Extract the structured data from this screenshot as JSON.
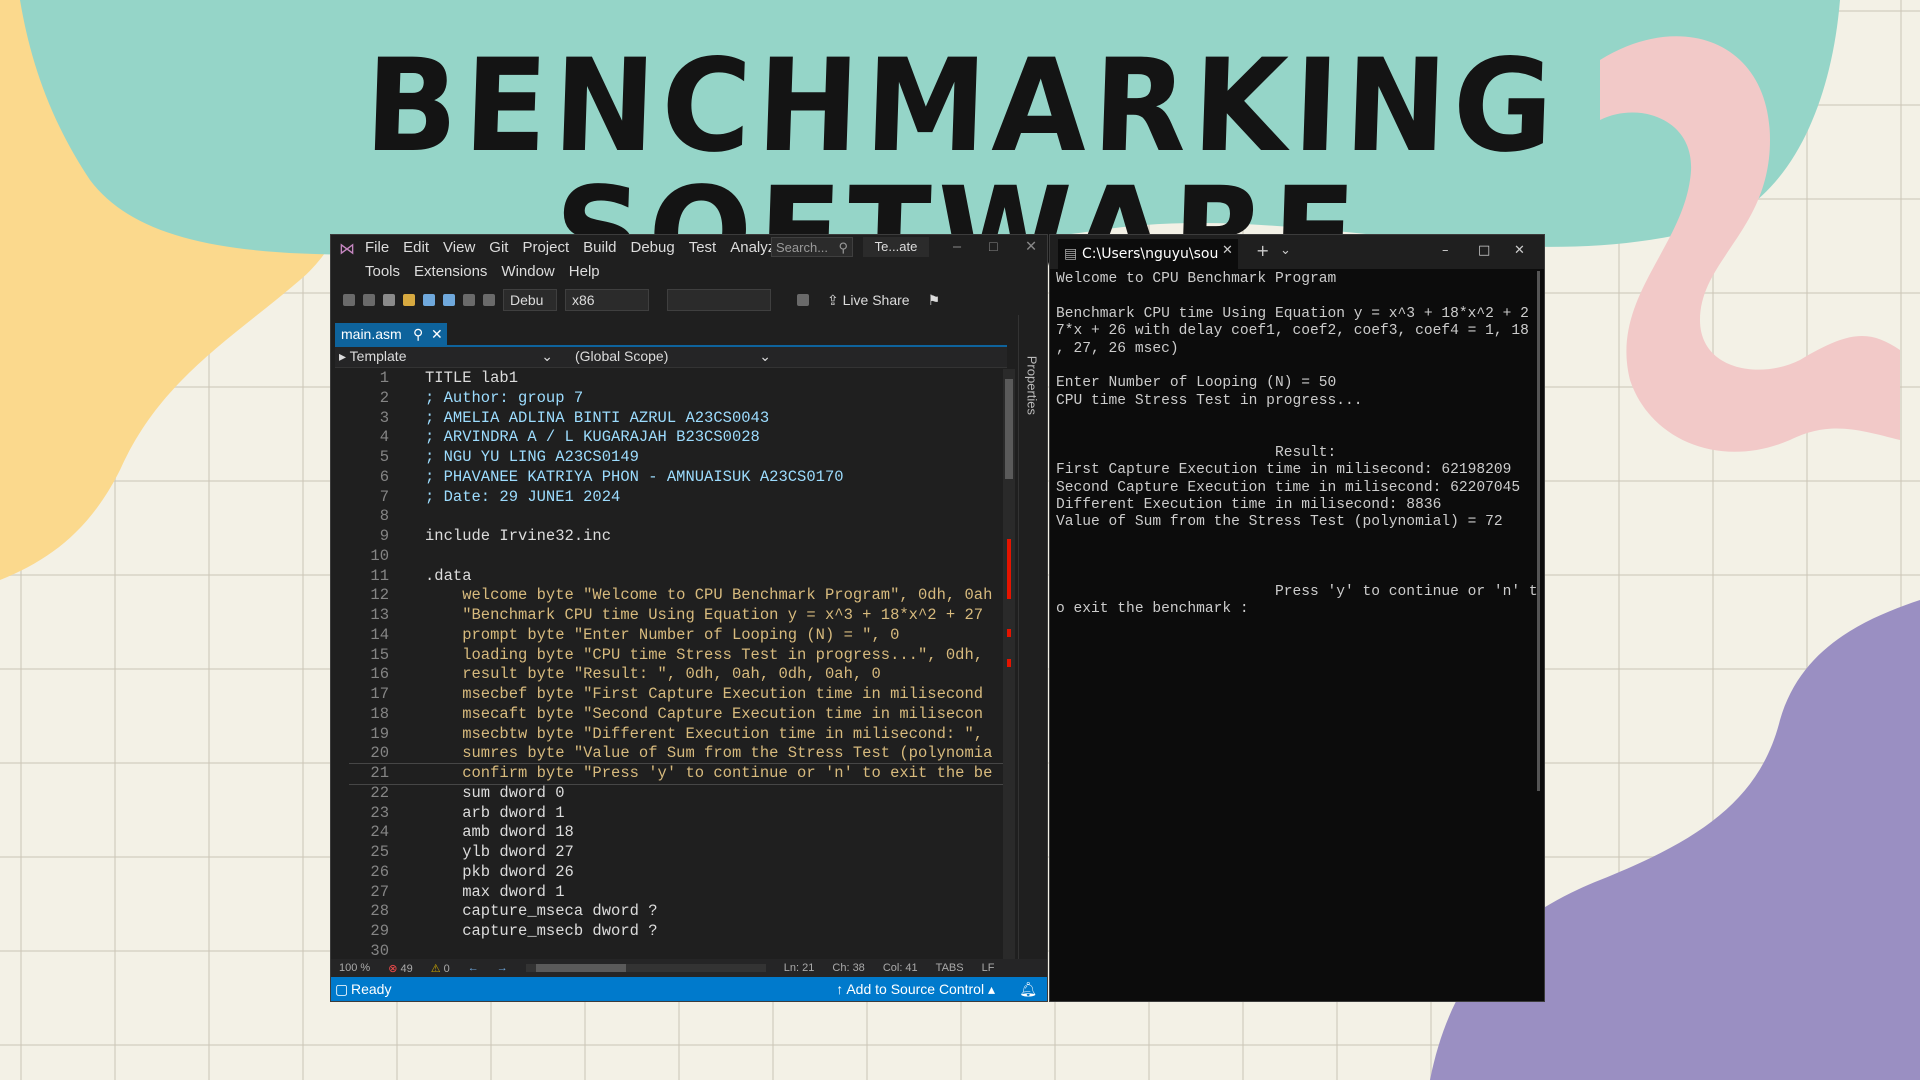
{
  "slide": {
    "title": "BENCHMARKING SOFTWARE",
    "colors": {
      "teal": "#95d5c8",
      "yellow": "#fbd98d",
      "pink": "#f2c9c8",
      "purple": "#9a8fc2",
      "background": "#f3f1e6"
    }
  },
  "vs": {
    "menu_row1": [
      "File",
      "Edit",
      "View",
      "Git",
      "Project",
      "Build",
      "Debug",
      "Test",
      "Analyze"
    ],
    "menu_row2": [
      "Tools",
      "Extensions",
      "Window",
      "Help"
    ],
    "search_placeholder": "Search...",
    "window_title": "Te...ate",
    "config": "Debu",
    "platform": "x86",
    "live_share": "Live Share",
    "tab_label": "main.asm",
    "nav_left": "Template",
    "nav_right": "(Global Scope)",
    "properties_label": "Properties",
    "zoom": "100 %",
    "errors": "49",
    "warnings": "0",
    "ln": "Ln: 21",
    "ch": "Ch: 38",
    "col": "Col: 41",
    "tabs": "TABS",
    "eol": "LF",
    "status": "Ready",
    "source_control": "Add to Source Control",
    "code_lines": [
      {
        "n": "1",
        "t": "TITLE lab1"
      },
      {
        "n": "2",
        "t": "; Author: group 7"
      },
      {
        "n": "3",
        "t": "; AMELIA ADLINA BINTI AZRUL A23CS0043"
      },
      {
        "n": "4",
        "t": "; ARVINDRA A / L KUGARAJAH B23CS0028"
      },
      {
        "n": "5",
        "t": "; NGU YU LING A23CS0149"
      },
      {
        "n": "6",
        "t": "; PHAVANEE KATRIYA PHON - AMNUAISUK A23CS0170"
      },
      {
        "n": "7",
        "t": "; Date: 29 JUNE1 2024"
      },
      {
        "n": "8",
        "t": ""
      },
      {
        "n": "9",
        "t": "include Irvine32.inc"
      },
      {
        "n": "10",
        "t": ""
      },
      {
        "n": "11",
        "t": ".data"
      },
      {
        "n": "12",
        "t": "    welcome byte \"Welcome to CPU Benchmark Program\", 0dh, 0ah"
      },
      {
        "n": "13",
        "t": "    \"Benchmark CPU time Using Equation y = x^3 + 18*x^2 + 27"
      },
      {
        "n": "14",
        "t": "    prompt byte \"Enter Number of Looping (N) = \", 0"
      },
      {
        "n": "15",
        "t": "    loading byte \"CPU time Stress Test in progress...\", 0dh,"
      },
      {
        "n": "16",
        "t": "    result byte \"Result: \", 0dh, 0ah, 0dh, 0ah, 0"
      },
      {
        "n": "17",
        "t": "    msecbef byte \"First Capture Execution time in milisecond"
      },
      {
        "n": "18",
        "t": "    msecaft byte \"Second Capture Execution time in milisecon"
      },
      {
        "n": "19",
        "t": "    msecbtw byte \"Different Execution time in milisecond: \","
      },
      {
        "n": "20",
        "t": "    sumres byte \"Value of Sum from the Stress Test (polynomia"
      },
      {
        "n": "21",
        "t": "    confirm byte \"Press 'y' to continue or 'n' to exit the be"
      },
      {
        "n": "22",
        "t": "    sum dword 0"
      },
      {
        "n": "23",
        "t": "    arb dword 1"
      },
      {
        "n": "24",
        "t": "    amb dword 18"
      },
      {
        "n": "25",
        "t": "    ylb dword 27"
      },
      {
        "n": "26",
        "t": "    pkb dword 26"
      },
      {
        "n": "27",
        "t": "    max dword 1"
      },
      {
        "n": "28",
        "t": "    capture_mseca dword ?"
      },
      {
        "n": "29",
        "t": "    capture_msecb dword ?"
      },
      {
        "n": "30",
        "t": ""
      }
    ]
  },
  "console": {
    "tab_title": "C:\\Users\\nguyu\\sou",
    "lines": [
      "Welcome to CPU Benchmark Program",
      "",
      "Benchmark CPU time Using Equation y = x^3 + 18*x^2 + 2",
      "7*x + 26 with delay coef1, coef2, coef3, coef4 = 1, 18",
      ", 27, 26 msec)",
      "",
      "Enter Number of Looping (N) = 50",
      "CPU time Stress Test in progress...",
      "",
      "",
      "                         Result:",
      "First Capture Execution time in milisecond: 62198209",
      "Second Capture Execution time in milisecond: 62207045",
      "Different Execution time in milisecond: 8836",
      "Value of Sum from the Stress Test (polynomial) = 72",
      "",
      "",
      "",
      "                         Press 'y' to continue or 'n' t",
      "o exit the benchmark :"
    ]
  }
}
